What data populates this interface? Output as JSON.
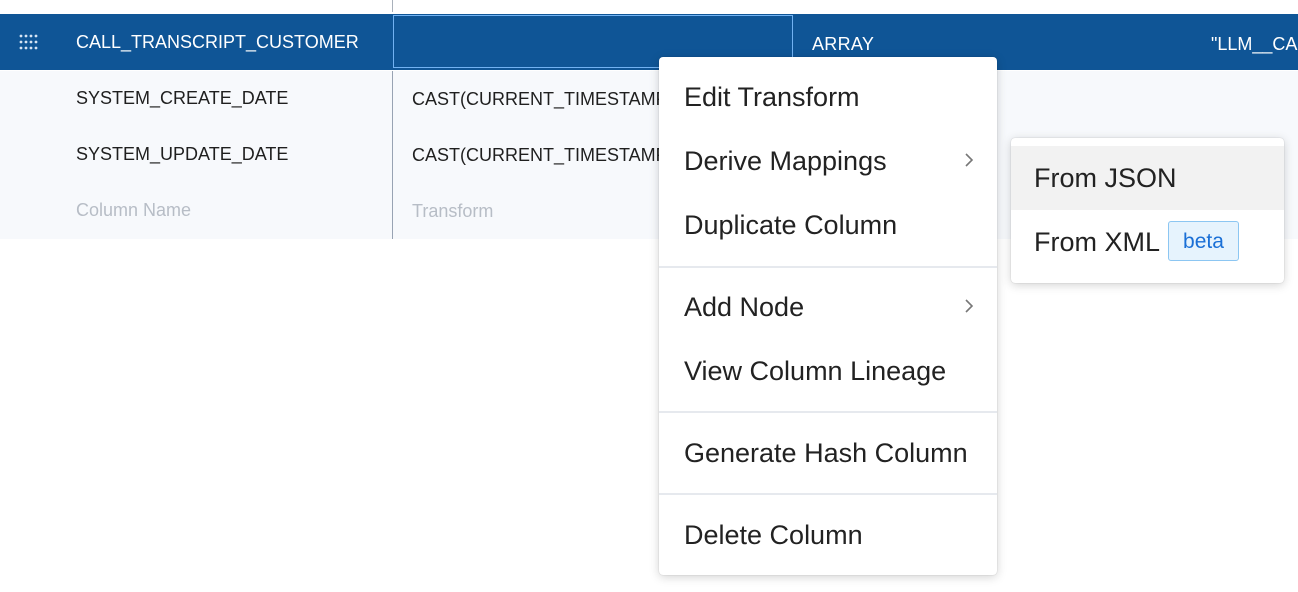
{
  "grid": {
    "rows": [
      {
        "name": "CALL_TRANSCRIPT_CUSTOMER",
        "transform": "",
        "type": "ARRAY",
        "expression": "\"LLM__CA"
      },
      {
        "name": "SYSTEM_CREATE_DATE",
        "transform": "CAST(CURRENT_TIMESTAMP"
      },
      {
        "name": "SYSTEM_UPDATE_DATE",
        "transform": "CAST(CURRENT_TIMESTAMP"
      }
    ],
    "new_row": {
      "name_placeholder": "Column Name",
      "transform_placeholder": "Transform"
    }
  },
  "context_menu": {
    "items": [
      "Edit Transform",
      "Derive Mappings",
      "Duplicate Column",
      "Add Node",
      "View Column Lineage",
      "Generate Hash Column",
      "Delete Column"
    ]
  },
  "submenu": {
    "from_json": "From JSON",
    "from_xml": "From XML",
    "beta": "beta"
  },
  "colors": {
    "selected_row": "#0f5596",
    "accent_border": "#72b2f2",
    "badge_text": "#1a6fd6"
  },
  "icons": {
    "drag_handle": "drag-handle-icon",
    "submenu_arrow": "chevron-right-icon"
  }
}
